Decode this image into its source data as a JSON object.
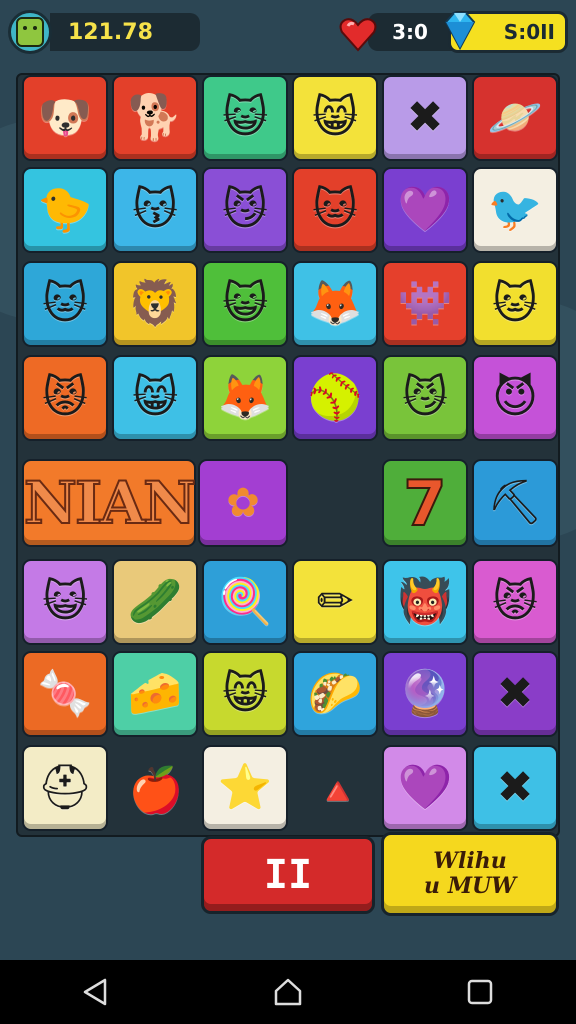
{
  "hud": {
    "score": "121.78",
    "lives": "3:0",
    "gems": "S:0II",
    "avatar_icon": "monster-face-icon",
    "heart_icon": "heart-icon",
    "gem_icon": "diamond-icon"
  },
  "board": {
    "tiles": [
      {
        "name": "dog-face-tile",
        "color": "#e3402a",
        "glyph": "🐶",
        "icon": "dog-face-icon"
      },
      {
        "name": "dog-face-tile",
        "color": "#e3402a",
        "glyph": "🐕",
        "icon": "dog-face-icon"
      },
      {
        "name": "cat-face-tile",
        "color": "#3fc98a",
        "glyph": "😺",
        "icon": "cat-face-icon"
      },
      {
        "name": "cat-face-tile",
        "color": "#f3e23a",
        "glyph": "😸",
        "icon": "cat-face-icon"
      },
      {
        "name": "crossed-pencils-tile",
        "color": "#b99be8",
        "glyph": "✖",
        "icon": "crossed-pencils-icon"
      },
      {
        "name": "planet-tile",
        "color": "#d6322e",
        "glyph": "🪐",
        "icon": "planet-icon"
      },
      {
        "name": "chick-tile",
        "color": "#34c4e0",
        "glyph": "🐤",
        "icon": "chick-icon"
      },
      {
        "name": "cat-face-tile",
        "color": "#3db6e8",
        "glyph": "😽",
        "icon": "cat-face-icon"
      },
      {
        "name": "cat-face-tile",
        "color": "#8a4fd6",
        "glyph": "😼",
        "icon": "cat-face-icon"
      },
      {
        "name": "cat-face-tile",
        "color": "#e3402a",
        "glyph": "🐱",
        "icon": "cat-face-icon"
      },
      {
        "name": "heart-pencil-tile",
        "color": "#7a3fd0",
        "glyph": "💜",
        "icon": "heart-pencil-icon"
      },
      {
        "name": "bird-face-tile",
        "color": "#f4efe2",
        "glyph": "🐦",
        "icon": "bird-face-icon"
      },
      {
        "name": "cat-face-tile",
        "color": "#2ea7d8",
        "glyph": "🐱",
        "icon": "cat-face-icon"
      },
      {
        "name": "lion-face-tile",
        "color": "#f1c52a",
        "glyph": "🦁",
        "icon": "lion-face-icon"
      },
      {
        "name": "cat-face-tile",
        "color": "#4fbf3a",
        "glyph": "😺",
        "icon": "cat-face-icon"
      },
      {
        "name": "fox-face-tile",
        "color": "#3fc1e6",
        "glyph": "🦊",
        "icon": "fox-face-icon"
      },
      {
        "name": "monster-face-tile",
        "color": "#e5402c",
        "glyph": "👾",
        "icon": "monster-face-icon"
      },
      {
        "name": "cat-face-tile",
        "color": "#f2df2e",
        "glyph": "🐱",
        "icon": "cat-face-icon"
      },
      {
        "name": "cat-face-tile",
        "color": "#ee6a25",
        "glyph": "😾",
        "icon": "cat-face-icon"
      },
      {
        "name": "cat-face-tile",
        "color": "#3ec0e6",
        "glyph": "😸",
        "icon": "cat-face-icon"
      },
      {
        "name": "fox-face-tile",
        "color": "#8ed33a",
        "glyph": "🦊",
        "icon": "fox-face-icon"
      },
      {
        "name": "leaf-ball-tile",
        "color": "#7a3fd0",
        "glyph": "🥎",
        "icon": "leaf-ball-icon"
      },
      {
        "name": "cat-face-tile",
        "color": "#79c43a",
        "glyph": "😼",
        "icon": "cat-face-icon"
      },
      {
        "name": "cat-face-tile",
        "color": "#c552d8",
        "glyph": "😈",
        "icon": "cat-face-icon"
      },
      {
        "name": "seven-tile",
        "color": "#4fae3a",
        "glyph": "",
        "icon": ""
      },
      {
        "name": "spade-tile",
        "color": "#2c9ad8",
        "glyph": "⛏",
        "icon": "spade-icon"
      },
      {
        "name": "cat-face-tile",
        "color": "#c47ae6",
        "glyph": "😺",
        "icon": "cat-face-icon"
      },
      {
        "name": "leaf-ball-tile",
        "color": "#e9c97a",
        "glyph": "🥒",
        "icon": "leaf-ball-icon"
      },
      {
        "name": "lollipop-tile",
        "color": "#2e9fd8",
        "glyph": "🍭",
        "icon": "lollipop-icon"
      },
      {
        "name": "pencil-ball-tile",
        "color": "#f3e23a",
        "glyph": "✏",
        "icon": "pencil-ball-icon"
      },
      {
        "name": "monster-face-tile",
        "color": "#3ec4ea",
        "glyph": "👹",
        "icon": "monster-face-icon"
      },
      {
        "name": "cat-face-tile",
        "color": "#d95bd0",
        "glyph": "😾",
        "icon": "cat-face-icon"
      },
      {
        "name": "candy-tile",
        "color": "#ec6a24",
        "glyph": "🍬",
        "icon": "candy-icon"
      },
      {
        "name": "cheese-wedge-tile",
        "color": "#4ecfa6",
        "glyph": "🧀",
        "icon": "cheese-wedge-icon"
      },
      {
        "name": "cat-face-tile",
        "color": "#c7d92e",
        "glyph": "😸",
        "icon": "cat-face-icon"
      },
      {
        "name": "taco-tile",
        "color": "#2fa4dc",
        "glyph": "🌮",
        "icon": "taco-icon"
      },
      {
        "name": "ball-tile",
        "color": "#7a3fd0",
        "glyph": "🔮",
        "icon": "ball-icon"
      },
      {
        "name": "crossed-pencils-tile",
        "color": "#8a3dc8",
        "glyph": "✖",
        "icon": "crossed-pencils-icon"
      },
      {
        "name": "helmet-tile",
        "color": "#f3ecc6",
        "glyph": "⛑",
        "icon": "helmet-icon"
      },
      {
        "name": "star-tile",
        "color": "#f4efe2",
        "glyph": "⭐",
        "icon": "star-icon"
      },
      {
        "name": "heart-tile",
        "color": "#d28ae8",
        "glyph": "💜",
        "icon": "heart-icon"
      },
      {
        "name": "crossed-pencils-tile",
        "color": "#3ec0e6",
        "glyph": "✖",
        "icon": "crossed-pencils-icon"
      }
    ],
    "banner_text": "NIAN",
    "seven_text": "7",
    "puzzle_tile_glyph": "✿",
    "loose_items": [
      {
        "name": "apple-pickup",
        "glyph": "🍎",
        "icon": "apple-icon"
      },
      {
        "name": "triangle-pickup",
        "glyph": "🔺",
        "icon": "triangle-icon"
      }
    ]
  },
  "controls": {
    "pause_label": "II",
    "word_line1": "Wlihu",
    "word_line2": "u MUW"
  },
  "navbar": {
    "back_icon": "back-triangle-icon",
    "home_icon": "home-icon",
    "recents_icon": "recents-square-icon"
  }
}
